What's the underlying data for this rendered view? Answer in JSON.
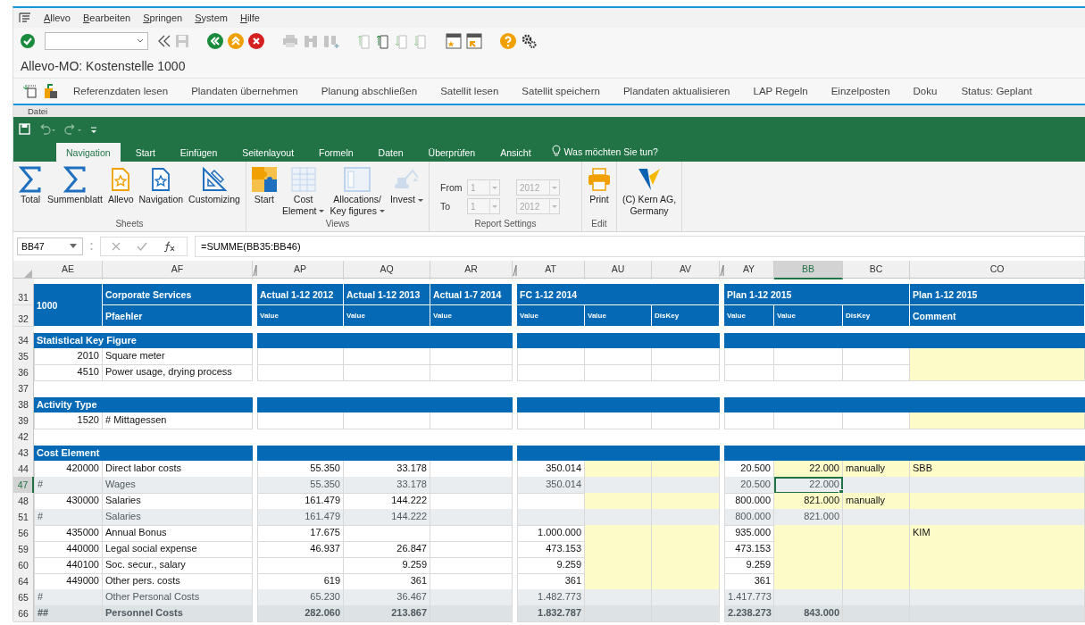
{
  "sap": {
    "menu": [
      "Allevo",
      "Bearbeiten",
      "Springen",
      "System",
      "Hilfe"
    ],
    "title": "Allevo-MO: Kostenstelle 1000",
    "app_toolbar": [
      "Referenzdaten lesen",
      "Plandaten übernehmen",
      "Planung abschließen",
      "Satellit lesen",
      "Satellit speichern",
      "Plandaten aktualisieren",
      "LAP Regeln",
      "Einzelposten",
      "Doku"
    ],
    "status": "Status: Geplant"
  },
  "excel": {
    "file_tab": "Datei",
    "tabs": [
      {
        "label": "Navigation",
        "selected": true
      },
      {
        "label": "Start",
        "selected": false
      },
      {
        "label": "Einfügen",
        "selected": false
      },
      {
        "label": "Seitenlayout",
        "selected": false
      },
      {
        "label": "Formeln",
        "selected": false
      },
      {
        "label": "Daten",
        "selected": false
      },
      {
        "label": "Überprüfen",
        "selected": false
      },
      {
        "label": "Ansicht",
        "selected": false
      }
    ],
    "tell_me": "Was möchten Sie tun?",
    "ribbon": [
      {
        "kind": "buttons",
        "label": "Sheets",
        "buttons": [
          {
            "label": "Total",
            "disabled": false,
            "dropdown": false
          },
          {
            "label": "Summenblatt",
            "disabled": false,
            "dropdown": false
          },
          {
            "label": "Allevo",
            "disabled": false,
            "dropdown": false
          },
          {
            "label": "Navigation",
            "disabled": false,
            "dropdown": false
          },
          {
            "label": "Customizing",
            "disabled": false,
            "dropdown": false
          }
        ]
      },
      {
        "kind": "buttons",
        "label": "Views",
        "buttons": [
          {
            "label": "Start",
            "disabled": false,
            "dropdown": false
          },
          {
            "label": "Cost\nElement",
            "disabled": true,
            "dropdown": true
          },
          {
            "label": "Allocations/\nKey figures",
            "disabled": true,
            "dropdown": true
          },
          {
            "label": "Invest",
            "disabled": true,
            "dropdown": true
          }
        ]
      },
      {
        "kind": "settings",
        "label": "Report Settings",
        "disabled": true,
        "rows": [
          {
            "label": "From",
            "period": "1",
            "year": "2012"
          },
          {
            "label": "To",
            "period": "1",
            "year": "2012"
          }
        ]
      },
      {
        "kind": "buttons",
        "label": "Edit",
        "buttons": [
          {
            "label": "Print",
            "disabled": false,
            "dropdown": false
          }
        ]
      },
      {
        "kind": "buttons",
        "buttons": [
          {
            "label": "(C) Kern AG,\nGermany",
            "disabled": false,
            "dropdown": false
          }
        ]
      }
    ],
    "name_box": "BB47",
    "formula": "=SUMME(BB35:BB46)",
    "columns": [
      {
        "letter": "AE",
        "selected": false,
        "hidden_before": false,
        "kind": "number",
        "title": "1000"
      },
      {
        "letter": "AF",
        "selected": false,
        "hidden_before": false,
        "kind": "label",
        "title": "Corporate Services",
        "subtitle": "Pfaehler"
      },
      {
        "letter": "AP",
        "selected": false,
        "hidden_before": true,
        "kind": "number",
        "title": "Actual 1-12 2012",
        "subtitle": "Value"
      },
      {
        "letter": "AQ",
        "selected": false,
        "hidden_before": false,
        "kind": "number",
        "title": "Actual 1-12 2013",
        "subtitle": "Value"
      },
      {
        "letter": "AR",
        "selected": false,
        "hidden_before": false,
        "kind": "number",
        "title": "Actual 1-7 2014",
        "subtitle": "Value"
      },
      {
        "letter": "AT",
        "selected": false,
        "hidden_before": true,
        "kind": "number",
        "title": "FC 1-12 2014",
        "subtitle": "Value"
      },
      {
        "letter": "AU",
        "selected": false,
        "hidden_before": false,
        "kind": "number",
        "subtitle": "Value"
      },
      {
        "letter": "AV",
        "selected": false,
        "hidden_before": false,
        "kind": "key",
        "subtitle": "DisKey"
      },
      {
        "letter": "AY",
        "selected": false,
        "hidden_before": true,
        "kind": "number",
        "title": "Plan 1-12 2015",
        "subtitle": "Value"
      },
      {
        "letter": "BB",
        "selected": true,
        "hidden_before": false,
        "kind": "number",
        "subtitle": "Value"
      },
      {
        "letter": "BC",
        "selected": false,
        "hidden_before": false,
        "kind": "key",
        "subtitle": "DisKey"
      },
      {
        "letter": "CO",
        "selected": false,
        "hidden_before": false,
        "kind": "label",
        "title": "Plan 1-12 2015",
        "subtitle": "Comment"
      }
    ],
    "header_rows": [
      "31",
      "32"
    ],
    "rows": [
      {
        "num": "34",
        "kind": "section",
        "selected": false,
        "title": "Statistical Key Figure"
      },
      {
        "num": "35",
        "kind": "item",
        "selected": false,
        "cells": [
          {
            "value": "2010",
            "input": false
          },
          {
            "value": "Square meter",
            "input": false
          },
          {
            "input": false
          },
          {
            "input": false
          },
          {
            "input": false
          },
          {
            "input": false
          },
          {
            "input": false
          },
          {
            "input": false
          },
          {
            "input": false
          },
          {
            "input": false
          },
          {
            "input": false
          },
          {
            "input": true
          }
        ]
      },
      {
        "num": "36",
        "kind": "item",
        "selected": false,
        "cells": [
          {
            "value": "4510",
            "input": false
          },
          {
            "value": "Power usage, drying process",
            "input": false
          },
          {
            "input": false
          },
          {
            "input": false
          },
          {
            "input": false
          },
          {
            "input": false
          },
          {
            "input": false
          },
          {
            "input": false
          },
          {
            "input": false
          },
          {
            "input": false
          },
          {
            "input": false
          },
          {
            "input": true
          }
        ]
      },
      {
        "num": "37",
        "kind": "blank",
        "selected": false
      },
      {
        "num": "38",
        "kind": "section",
        "selected": false,
        "title": "Activity Type"
      },
      {
        "num": "39",
        "kind": "item",
        "selected": false,
        "cells": [
          {
            "value": "1520",
            "input": false
          },
          {
            "value": "# Mittagessen",
            "input": false
          },
          {
            "input": false
          },
          {
            "input": false
          },
          {
            "input": false
          },
          {
            "input": false
          },
          {
            "input": false
          },
          {
            "input": false
          },
          {
            "input": false
          },
          {
            "input": false
          },
          {
            "input": false
          },
          {
            "input": true
          }
        ]
      },
      {
        "num": "42",
        "kind": "blank",
        "selected": false
      },
      {
        "num": "43",
        "kind": "section",
        "selected": false,
        "title": "Cost Element"
      },
      {
        "num": "44",
        "kind": "item",
        "selected": false,
        "cells": [
          {
            "value": "420000",
            "input": false
          },
          {
            "value": "Direct labor costs",
            "input": false
          },
          {
            "value": "55.350",
            "input": false
          },
          {
            "value": "33.178",
            "input": false
          },
          {
            "input": false
          },
          {
            "value": "350.014",
            "input": false
          },
          {
            "input": true
          },
          {
            "input": true
          },
          {
            "value": "20.500",
            "input": false
          },
          {
            "value": "22.000",
            "input": true
          },
          {
            "value": "manually",
            "input": true
          },
          {
            "value": "SBB",
            "input": true
          }
        ]
      },
      {
        "num": "47",
        "kind": "subtotal",
        "selected": true,
        "cells": [
          {
            "value": "#",
            "input": false
          },
          {
            "value": "Wages",
            "input": false
          },
          {
            "value": "55.350",
            "input": false
          },
          {
            "value": "33.178",
            "input": false
          },
          {
            "input": false
          },
          {
            "value": "350.014",
            "input": false
          },
          {
            "input": false
          },
          {
            "input": false
          },
          {
            "value": "20.500",
            "input": false
          },
          {
            "value": "22.000",
            "input": false
          },
          {
            "input": false
          },
          {
            "input": false
          }
        ]
      },
      {
        "num": "48",
        "kind": "item",
        "selected": false,
        "cells": [
          {
            "value": "430000",
            "input": false
          },
          {
            "value": "Salaries",
            "input": false
          },
          {
            "value": "161.479",
            "input": false
          },
          {
            "value": "144.222",
            "input": false
          },
          {
            "input": false
          },
          {
            "input": false
          },
          {
            "input": true
          },
          {
            "input": true
          },
          {
            "value": "800.000",
            "input": false
          },
          {
            "value": "821.000",
            "input": true
          },
          {
            "value": "manually",
            "input": true
          },
          {
            "input": true
          }
        ]
      },
      {
        "num": "51",
        "kind": "subtotal",
        "selected": false,
        "cells": [
          {
            "value": "#",
            "input": false
          },
          {
            "value": "Salaries",
            "input": false
          },
          {
            "value": "161.479",
            "input": false
          },
          {
            "value": "144.222",
            "input": false
          },
          {
            "input": false
          },
          {
            "input": false
          },
          {
            "input": false
          },
          {
            "input": false
          },
          {
            "value": "800.000",
            "input": false
          },
          {
            "value": "821.000",
            "input": false
          },
          {
            "input": false
          },
          {
            "input": false
          }
        ]
      },
      {
        "num": "56",
        "kind": "item",
        "selected": false,
        "cells": [
          {
            "value": "435000",
            "input": false
          },
          {
            "value": "Annual Bonus",
            "input": false
          },
          {
            "value": "17.675",
            "input": false
          },
          {
            "input": false
          },
          {
            "input": false
          },
          {
            "value": "1.000.000",
            "input": false
          },
          {
            "input": true
          },
          {
            "input": true
          },
          {
            "value": "935.000",
            "input": false
          },
          {
            "input": true
          },
          {
            "input": true
          },
          {
            "value": "KIM",
            "input": true
          }
        ]
      },
      {
        "num": "59",
        "kind": "item",
        "selected": false,
        "cells": [
          {
            "value": "440000",
            "input": false
          },
          {
            "value": "Legal social expense",
            "input": false
          },
          {
            "value": "46.937",
            "input": false
          },
          {
            "value": "26.847",
            "input": false
          },
          {
            "input": false
          },
          {
            "value": "473.153",
            "input": false
          },
          {
            "input": true
          },
          {
            "input": true
          },
          {
            "value": "473.153",
            "input": false
          },
          {
            "input": true
          },
          {
            "input": true
          },
          {
            "input": true
          }
        ]
      },
      {
        "num": "60",
        "kind": "item",
        "selected": false,
        "cells": [
          {
            "value": "440100",
            "input": false
          },
          {
            "value": "Soc. secur., salary",
            "input": false
          },
          {
            "input": false
          },
          {
            "value": "9.259",
            "input": false
          },
          {
            "input": false
          },
          {
            "value": "9.259",
            "input": false
          },
          {
            "input": true
          },
          {
            "input": true
          },
          {
            "value": "9.259",
            "input": false
          },
          {
            "input": true
          },
          {
            "input": true
          },
          {
            "input": true
          }
        ]
      },
      {
        "num": "64",
        "kind": "item",
        "selected": false,
        "cells": [
          {
            "value": "449000",
            "input": false
          },
          {
            "value": "Other pers. costs",
            "input": false
          },
          {
            "value": "619",
            "input": false
          },
          {
            "value": "361",
            "input": false
          },
          {
            "input": false
          },
          {
            "value": "361",
            "input": false
          },
          {
            "input": true
          },
          {
            "input": true
          },
          {
            "value": "361",
            "input": false
          },
          {
            "input": true
          },
          {
            "input": true
          },
          {
            "input": true
          }
        ]
      },
      {
        "num": "65",
        "kind": "subtotal",
        "selected": false,
        "cells": [
          {
            "value": "#",
            "input": false
          },
          {
            "value": "Other Personal Costs",
            "input": false
          },
          {
            "value": "65.230",
            "input": false
          },
          {
            "value": "36.467",
            "input": false
          },
          {
            "input": false
          },
          {
            "value": "1.482.773",
            "input": false
          },
          {
            "input": false
          },
          {
            "input": false
          },
          {
            "value": "1.417.773",
            "input": false
          },
          {
            "input": false
          },
          {
            "input": false
          },
          {
            "input": false
          }
        ]
      },
      {
        "num": "66",
        "kind": "total",
        "selected": false,
        "cells": [
          {
            "value": "##",
            "input": false
          },
          {
            "value": "Personnel Costs",
            "input": false
          },
          {
            "value": "282.060",
            "input": false
          },
          {
            "value": "213.867",
            "input": false
          },
          {
            "input": false
          },
          {
            "value": "1.832.787",
            "input": false
          },
          {
            "input": false
          },
          {
            "input": false
          },
          {
            "value": "2.238.273",
            "input": false
          },
          {
            "value": "843.000",
            "input": false
          },
          {
            "input": false
          },
          {
            "input": false
          }
        ]
      }
    ]
  }
}
